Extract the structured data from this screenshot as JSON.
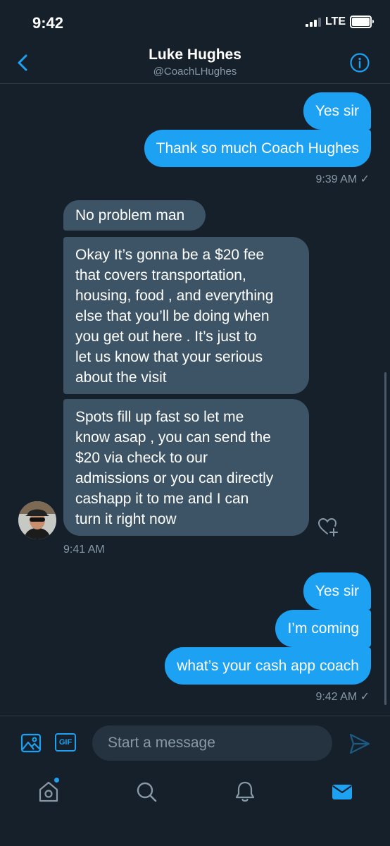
{
  "status_bar": {
    "time": "9:42",
    "network": "LTE",
    "signal_bars_active": 3,
    "signal_bars_total": 4
  },
  "header": {
    "name": "Luke Hughes",
    "handle": "@CoachLHughes",
    "back_icon": "chevron-left-icon",
    "info_icon": "info-circle-icon"
  },
  "messages": [
    {
      "direction": "outgoing",
      "text": "Yes sir"
    },
    {
      "direction": "outgoing",
      "text": "Thank so much Coach Hughes"
    },
    {
      "direction": "meta",
      "text": "9:39 AM ✓"
    },
    {
      "direction": "incoming",
      "text": "No problem man"
    },
    {
      "direction": "incoming",
      "text": "Okay It’s gonna be a $20 fee\nthat covers transportation,\nhousing, food , and everything\nelse that you’ll be doing when\nyou get out here . It’s just to\nlet us know that your serious\nabout the visit"
    },
    {
      "direction": "incoming",
      "text": "Spots fill up fast so let me\nknow asap , you can send the\n$20 via check to our\nadmissions or you can directly\ncashapp it to me and I can\nturn it right now"
    },
    {
      "direction": "meta",
      "text": "9:41 AM"
    },
    {
      "direction": "outgoing",
      "text": "Yes sir"
    },
    {
      "direction": "outgoing",
      "text": "I’m coming"
    },
    {
      "direction": "outgoing",
      "text": "what’s your cash app coach"
    },
    {
      "direction": "meta",
      "text": "9:42 AM ✓"
    }
  ],
  "composer": {
    "placeholder": "Start a message",
    "gif_label": "GIF",
    "media_icon": "image-icon",
    "send_icon": "send-icon"
  },
  "tabs": [
    {
      "name": "home",
      "icon": "home-icon",
      "has_notification": true
    },
    {
      "name": "search",
      "icon": "search-icon",
      "has_notification": false
    },
    {
      "name": "notifications",
      "icon": "bell-icon",
      "has_notification": false
    },
    {
      "name": "messages",
      "icon": "mail-icon",
      "active": true
    }
  ],
  "colors": {
    "background": "#15202b",
    "accent": "#1da1f2",
    "incoming_bubble": "#3d5466",
    "muted_text": "#8899a6"
  }
}
